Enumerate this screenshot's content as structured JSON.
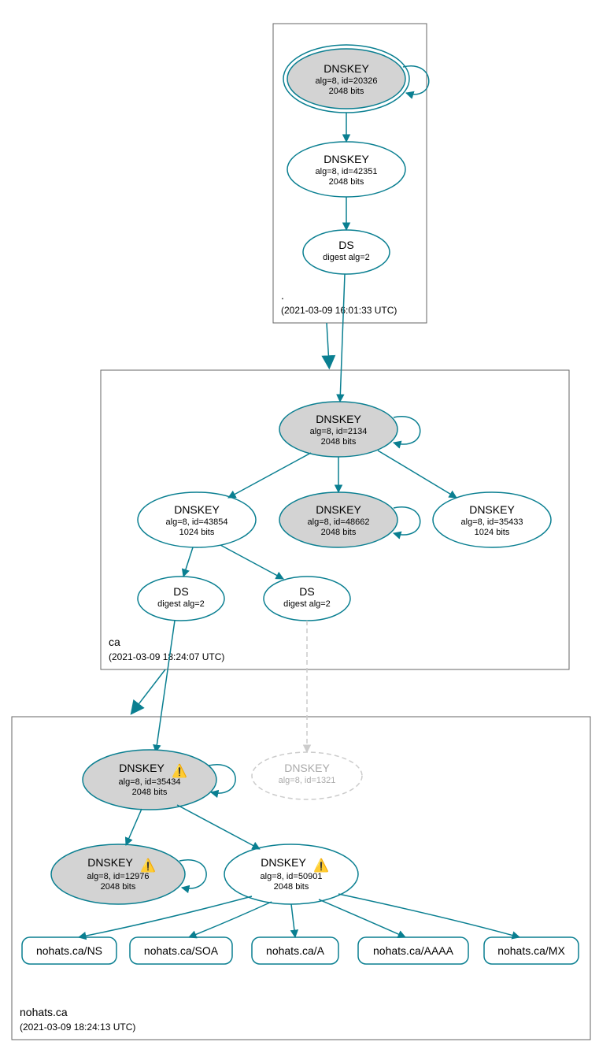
{
  "zones": {
    "root": {
      "label": ".",
      "timestamp": "(2021-03-09 16:01:33 UTC)"
    },
    "ca": {
      "label": "ca",
      "timestamp": "(2021-03-09 18:24:07 UTC)"
    },
    "nohats": {
      "label": "nohats.ca",
      "timestamp": "(2021-03-09 18:24:13 UTC)"
    }
  },
  "nodes": {
    "root_ksk": {
      "title": "DNSKEY",
      "line2": "alg=8, id=20326",
      "line3": "2048 bits"
    },
    "root_zsk": {
      "title": "DNSKEY",
      "line2": "alg=8, id=42351",
      "line3": "2048 bits"
    },
    "root_ds": {
      "title": "DS",
      "line2": "digest alg=2"
    },
    "ca_ksk": {
      "title": "DNSKEY",
      "line2": "alg=8, id=2134",
      "line3": "2048 bits"
    },
    "ca_zsk_l": {
      "title": "DNSKEY",
      "line2": "alg=8, id=43854",
      "line3": "1024 bits"
    },
    "ca_zsk_m": {
      "title": "DNSKEY",
      "line2": "alg=8, id=48662",
      "line3": "2048 bits"
    },
    "ca_zsk_r": {
      "title": "DNSKEY",
      "line2": "alg=8, id=35433",
      "line3": "1024 bits"
    },
    "ca_ds_l": {
      "title": "DS",
      "line2": "digest alg=2"
    },
    "ca_ds_r": {
      "title": "DS",
      "line2": "digest alg=2"
    },
    "nh_ksk": {
      "title": "DNSKEY",
      "line2": "alg=8, id=35434",
      "line3": "2048 bits"
    },
    "nh_missing": {
      "title": "DNSKEY",
      "line2": "alg=8, id=1321"
    },
    "nh_zsk_l": {
      "title": "DNSKEY",
      "line2": "alg=8, id=12976",
      "line3": "2048 bits"
    },
    "nh_zsk_r": {
      "title": "DNSKEY",
      "line2": "alg=8, id=50901",
      "line3": "2048 bits"
    },
    "rr_ns": {
      "label": "nohats.ca/NS"
    },
    "rr_soa": {
      "label": "nohats.ca/SOA"
    },
    "rr_a": {
      "label": "nohats.ca/A"
    },
    "rr_aaaa": {
      "label": "nohats.ca/AAAA"
    },
    "rr_mx": {
      "label": "nohats.ca/MX"
    }
  },
  "warn_glyph": "⚠️",
  "chart_data": {
    "type": "graph",
    "description": "DNSSEC authentication chain (DNSViz-style) for nohats.ca",
    "zones": [
      {
        "name": ".",
        "timestamp_utc": "2021-03-09 16:01:33"
      },
      {
        "name": "ca",
        "timestamp_utc": "2021-03-09 18:24:07"
      },
      {
        "name": "nohats.ca",
        "timestamp_utc": "2021-03-09 18:24:13"
      }
    ],
    "nodes": [
      {
        "id": "root_ksk",
        "zone": ".",
        "type": "DNSKEY",
        "alg": 8,
        "key_id": 20326,
        "bits": 2048,
        "role": "KSK",
        "trust_anchor": true,
        "self_sig": true
      },
      {
        "id": "root_zsk",
        "zone": ".",
        "type": "DNSKEY",
        "alg": 8,
        "key_id": 42351,
        "bits": 2048,
        "role": "ZSK"
      },
      {
        "id": "root_ds",
        "zone": ".",
        "type": "DS",
        "digest_alg": 2
      },
      {
        "id": "ca_ksk",
        "zone": "ca",
        "type": "DNSKEY",
        "alg": 8,
        "key_id": 2134,
        "bits": 2048,
        "role": "KSK",
        "self_sig": true
      },
      {
        "id": "ca_zsk_l",
        "zone": "ca",
        "type": "DNSKEY",
        "alg": 8,
        "key_id": 43854,
        "bits": 1024,
        "role": "ZSK"
      },
      {
        "id": "ca_zsk_m",
        "zone": "ca",
        "type": "DNSKEY",
        "alg": 8,
        "key_id": 48662,
        "bits": 2048,
        "role": "ZSK",
        "self_sig": true
      },
      {
        "id": "ca_zsk_r",
        "zone": "ca",
        "type": "DNSKEY",
        "alg": 8,
        "key_id": 35433,
        "bits": 1024,
        "role": "ZSK"
      },
      {
        "id": "ca_ds_l",
        "zone": "ca",
        "type": "DS",
        "digest_alg": 2
      },
      {
        "id": "ca_ds_r",
        "zone": "ca",
        "type": "DS",
        "digest_alg": 2
      },
      {
        "id": "nh_ksk",
        "zone": "nohats.ca",
        "type": "DNSKEY",
        "alg": 8,
        "key_id": 35434,
        "bits": 2048,
        "role": "KSK",
        "self_sig": true,
        "status": "warning"
      },
      {
        "id": "nh_missing",
        "zone": "nohats.ca",
        "type": "DNSKEY",
        "alg": 8,
        "key_id": 1321,
        "status": "missing"
      },
      {
        "id": "nh_zsk_l",
        "zone": "nohats.ca",
        "type": "DNSKEY",
        "alg": 8,
        "key_id": 12976,
        "bits": 2048,
        "role": "ZSK",
        "self_sig": true,
        "status": "warning"
      },
      {
        "id": "nh_zsk_r",
        "zone": "nohats.ca",
        "type": "DNSKEY",
        "alg": 8,
        "key_id": 50901,
        "bits": 2048,
        "role": "ZSK",
        "status": "warning"
      },
      {
        "id": "rr_ns",
        "zone": "nohats.ca",
        "type": "RRset",
        "name": "nohats.ca/NS"
      },
      {
        "id": "rr_soa",
        "zone": "nohats.ca",
        "type": "RRset",
        "name": "nohats.ca/SOA"
      },
      {
        "id": "rr_a",
        "zone": "nohats.ca",
        "type": "RRset",
        "name": "nohats.ca/A"
      },
      {
        "id": "rr_aaaa",
        "zone": "nohats.ca",
        "type": "RRset",
        "name": "nohats.ca/AAAA"
      },
      {
        "id": "rr_mx",
        "zone": "nohats.ca",
        "type": "RRset",
        "name": "nohats.ca/MX"
      }
    ],
    "edges": [
      {
        "from": "root_ksk",
        "to": "root_ksk",
        "kind": "self-sig"
      },
      {
        "from": "root_ksk",
        "to": "root_zsk",
        "kind": "signs"
      },
      {
        "from": "root_zsk",
        "to": "root_ds",
        "kind": "signs"
      },
      {
        "from": "root_ds",
        "to": "ca_ksk",
        "kind": "delegation"
      },
      {
        "from": "ca_ksk",
        "to": "ca_ksk",
        "kind": "self-sig"
      },
      {
        "from": "ca_ksk",
        "to": "ca_zsk_l",
        "kind": "signs"
      },
      {
        "from": "ca_ksk",
        "to": "ca_zsk_m",
        "kind": "signs"
      },
      {
        "from": "ca_ksk",
        "to": "ca_zsk_r",
        "kind": "signs"
      },
      {
        "from": "ca_zsk_m",
        "to": "ca_zsk_m",
        "kind": "self-sig"
      },
      {
        "from": "ca_zsk_l",
        "to": "ca_ds_l",
        "kind": "signs"
      },
      {
        "from": "ca_zsk_l",
        "to": "ca_ds_r",
        "kind": "signs"
      },
      {
        "from": "ca_ds_l",
        "to": "nh_ksk",
        "kind": "delegation"
      },
      {
        "from": "ca_ds_r",
        "to": "nh_missing",
        "kind": "delegation",
        "status": "broken"
      },
      {
        "from": "nh_ksk",
        "to": "nh_ksk",
        "kind": "self-sig"
      },
      {
        "from": "nh_ksk",
        "to": "nh_zsk_l",
        "kind": "signs"
      },
      {
        "from": "nh_ksk",
        "to": "nh_zsk_r",
        "kind": "signs"
      },
      {
        "from": "nh_zsk_l",
        "to": "nh_zsk_l",
        "kind": "self-sig"
      },
      {
        "from": "nh_zsk_r",
        "to": "rr_ns",
        "kind": "signs"
      },
      {
        "from": "nh_zsk_r",
        "to": "rr_soa",
        "kind": "signs"
      },
      {
        "from": "nh_zsk_r",
        "to": "rr_a",
        "kind": "signs"
      },
      {
        "from": "nh_zsk_r",
        "to": "rr_aaaa",
        "kind": "signs"
      },
      {
        "from": "nh_zsk_r",
        "to": "rr_mx",
        "kind": "signs"
      }
    ]
  }
}
